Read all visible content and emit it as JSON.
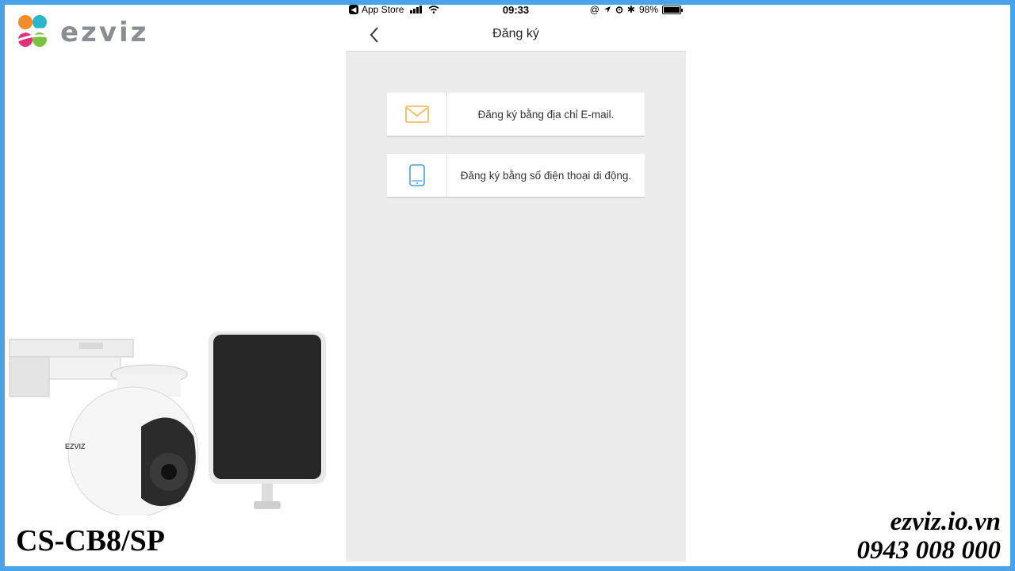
{
  "brand": {
    "name": "ezviz",
    "logo_icon": "ezviz-logo-icon"
  },
  "status_bar": {
    "back_app": "App Store",
    "time": "09:33",
    "battery": "98%",
    "battery_level": 0.98
  },
  "nav": {
    "title": "Đăng ký",
    "back_icon": "chevron-left-icon"
  },
  "options": [
    {
      "label": "Đăng ký bằng địa chỉ E-mail.",
      "icon": "mail-icon"
    },
    {
      "label": "Đăng ký bằng số điện thoại di động.",
      "icon": "mobile-phone-icon"
    }
  ],
  "product": {
    "model": "CS-CB8/SP",
    "camera_badge": "EZVIZ"
  },
  "contact": {
    "website": "ezviz.io.vn",
    "phone": "0943 008 000"
  },
  "colors": {
    "frame": "#4aa3e6",
    "email_icon": "#f0b54a",
    "phone_icon": "#4a9fe0",
    "app_bg": "#ececec"
  }
}
